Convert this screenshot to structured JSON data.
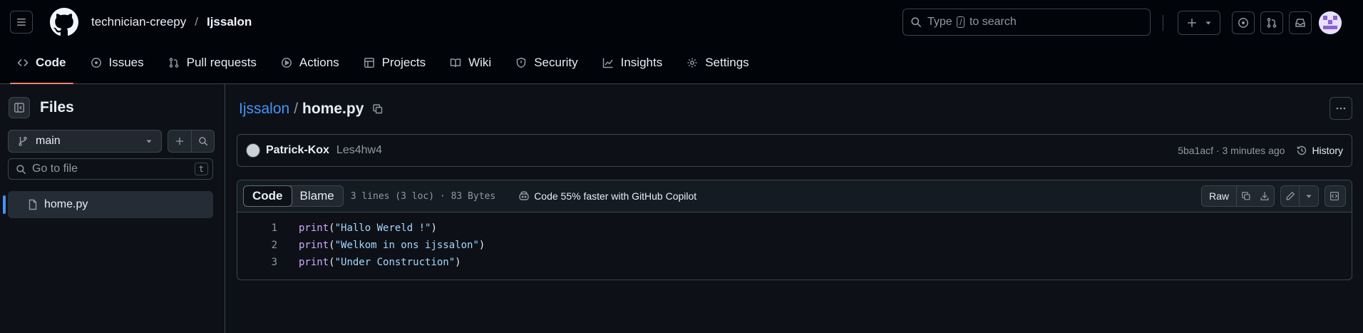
{
  "header": {
    "owner": "technician-creepy",
    "separator": "/",
    "repo": "Ijssalon",
    "search_prefix": "Type",
    "search_key": "/",
    "search_suffix": "to search"
  },
  "nav": {
    "tabs": [
      {
        "label": "Code",
        "icon": "code-icon",
        "active": true
      },
      {
        "label": "Issues",
        "icon": "issue-opened-icon"
      },
      {
        "label": "Pull requests",
        "icon": "git-pull-request-icon"
      },
      {
        "label": "Actions",
        "icon": "play-icon"
      },
      {
        "label": "Projects",
        "icon": "table-icon"
      },
      {
        "label": "Wiki",
        "icon": "book-icon"
      },
      {
        "label": "Security",
        "icon": "shield-icon"
      },
      {
        "label": "Insights",
        "icon": "graph-icon"
      },
      {
        "label": "Settings",
        "icon": "gear-icon"
      }
    ]
  },
  "sidebar": {
    "title": "Files",
    "branch": "main",
    "goto_placeholder": "Go to file",
    "goto_shortcut": "t",
    "files": [
      {
        "name": "home.py",
        "selected": true
      }
    ]
  },
  "file": {
    "repo_link": "Ijssalon",
    "separator": "/",
    "name": "home.py"
  },
  "commit": {
    "author": "Patrick-Kox",
    "message": "Les4hw4",
    "sha": "5ba1acf",
    "dot": "·",
    "time": "3 minutes ago",
    "history_label": "History"
  },
  "viewer": {
    "tab_code": "Code",
    "tab_blame": "Blame",
    "meta": "3 lines (3 loc) · 83 Bytes",
    "copilot": "Code 55% faster with GitHub Copilot",
    "raw_label": "Raw"
  },
  "code_lines": [
    {
      "n": "1",
      "fn": "print",
      "open": "(",
      "str": "\"Hallo Wereld !\"",
      "close": ")"
    },
    {
      "n": "2",
      "fn": "print",
      "open": "(",
      "str": "\"Welkom in ons ijssalon\"",
      "close": ")"
    },
    {
      "n": "3",
      "fn": "print",
      "open": "(",
      "str": "\"Under Construction\"",
      "close": ")"
    }
  ],
  "colors": {
    "bg": "#0d1117",
    "header_bg": "#010409",
    "link": "#4493f8",
    "active_underline": "#f78166",
    "function": "#d2a8ff",
    "string": "#a5d6ff"
  }
}
